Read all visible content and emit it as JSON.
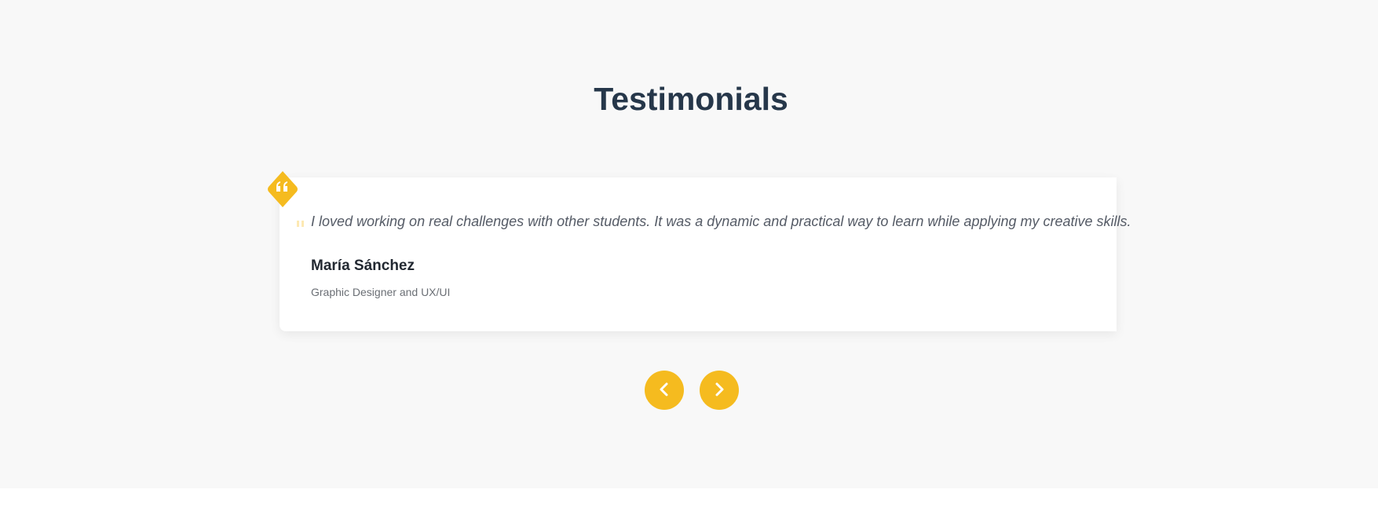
{
  "section": {
    "title": "Testimonials"
  },
  "testimonial": {
    "quote": "I loved working on real challenges with other students. It was a dynamic and practical way to learn while applying my creative skills.",
    "author_name": "María Sánchez",
    "author_role": "Graphic Designer and UX/UI"
  },
  "icons": {
    "badge": "quote-icon",
    "prev": "chevron-left-icon",
    "next": "chevron-right-icon"
  },
  "colors": {
    "accent": "#f5bb1f",
    "title": "#26374a",
    "background": "#f8f8f8",
    "card": "#ffffff"
  }
}
